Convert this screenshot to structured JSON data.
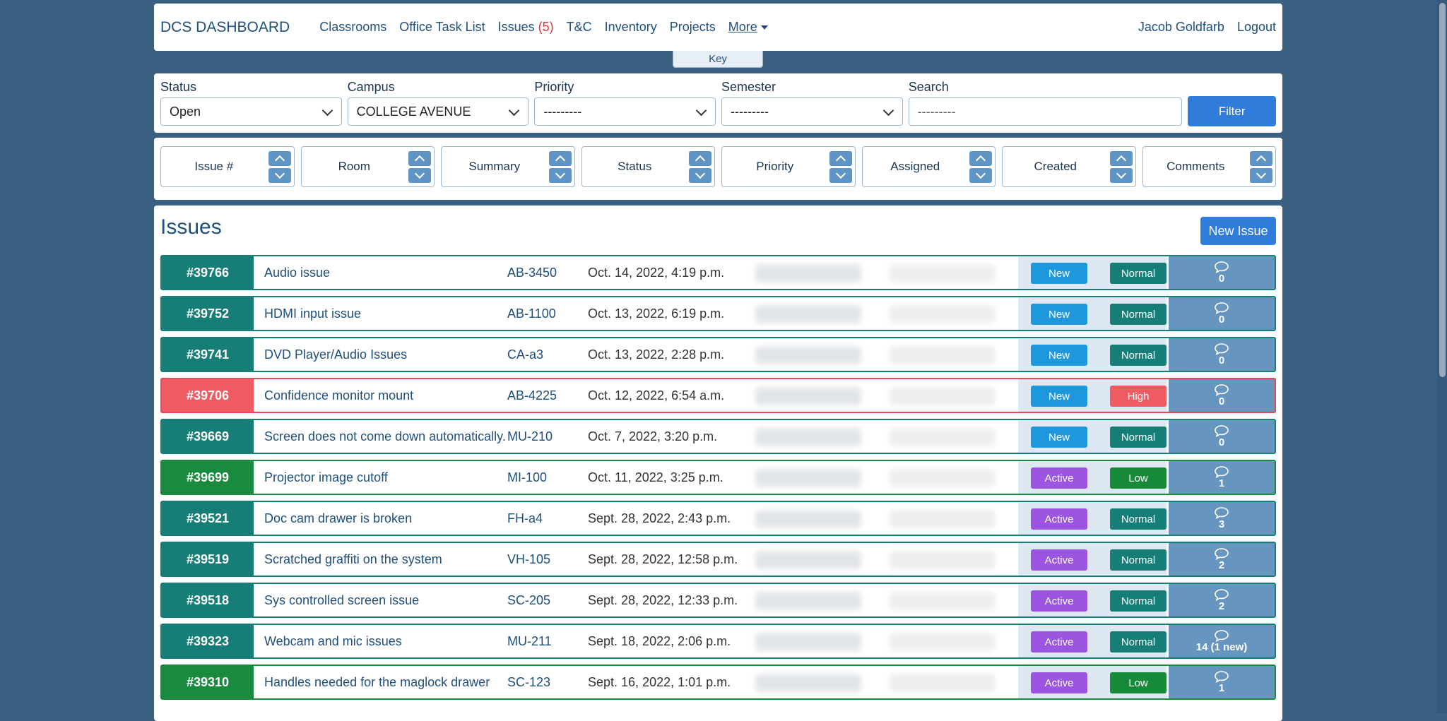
{
  "navbar": {
    "brand": "DCS DASHBOARD",
    "links": {
      "classrooms": "Classrooms",
      "office_task_list": "Office Task List",
      "issues": "Issues",
      "issues_count": "(5)",
      "tc": "T&C",
      "inventory": "Inventory",
      "projects": "Projects",
      "more": "More"
    },
    "user": "Jacob Goldfarb",
    "logout": "Logout",
    "key": "Key"
  },
  "filters": {
    "status": {
      "label": "Status",
      "value": "Open"
    },
    "campus": {
      "label": "Campus",
      "value": "COLLEGE AVENUE"
    },
    "priority": {
      "label": "Priority",
      "value": "---------"
    },
    "semester": {
      "label": "Semester",
      "value": "---------"
    },
    "search": {
      "label": "Search",
      "placeholder": "---------"
    },
    "filter_button": "Filter"
  },
  "sort_columns": [
    "Issue #",
    "Room",
    "Summary",
    "Status",
    "Priority",
    "Assigned",
    "Created",
    "Comments"
  ],
  "issues": {
    "title": "Issues",
    "new_issue_button": "New Issue",
    "rows": [
      {
        "num": "#39766",
        "summary": "Audio issue",
        "room": "AB-3450",
        "created": "Oct. 14, 2022, 4:19 p.m.",
        "status": "New",
        "priority": "Normal",
        "comments": "0"
      },
      {
        "num": "#39752",
        "summary": "HDMI input issue",
        "room": "AB-1100",
        "created": "Oct. 13, 2022, 6:19 p.m.",
        "status": "New",
        "priority": "Normal",
        "comments": "0"
      },
      {
        "num": "#39741",
        "summary": "DVD Player/Audio Issues",
        "room": "CA-a3",
        "created": "Oct. 13, 2022, 2:28 p.m.",
        "status": "New",
        "priority": "Normal",
        "comments": "0"
      },
      {
        "num": "#39706",
        "summary": "Confidence monitor mount",
        "room": "AB-4225",
        "created": "Oct. 12, 2022, 6:54 a.m.",
        "status": "New",
        "priority": "High",
        "comments": "0"
      },
      {
        "num": "#39669",
        "summary": "Screen does not come down automatically.",
        "room": "MU-210",
        "created": "Oct. 7, 2022, 3:20 p.m.",
        "status": "New",
        "priority": "Normal",
        "comments": "0"
      },
      {
        "num": "#39699",
        "summary": "Projector image cutoff",
        "room": "MI-100",
        "created": "Oct. 11, 2022, 3:25 p.m.",
        "status": "Active",
        "priority": "Low",
        "comments": "1"
      },
      {
        "num": "#39521",
        "summary": "Doc cam drawer is broken",
        "room": "FH-a4",
        "created": "Sept. 28, 2022, 2:43 p.m.",
        "status": "Active",
        "priority": "Normal",
        "comments": "3"
      },
      {
        "num": "#39519",
        "summary": "Scratched graffiti on the system",
        "room": "VH-105",
        "created": "Sept. 28, 2022, 12:58 p.m.",
        "status": "Active",
        "priority": "Normal",
        "comments": "2"
      },
      {
        "num": "#39518",
        "summary": "Sys controlled screen issue",
        "room": "SC-205",
        "created": "Sept. 28, 2022, 12:33 p.m.",
        "status": "Active",
        "priority": "Normal",
        "comments": "2"
      },
      {
        "num": "#39323",
        "summary": "Webcam and mic issues",
        "room": "MU-211",
        "created": "Sept. 18, 2022, 2:06 p.m.",
        "status": "Active",
        "priority": "Normal",
        "comments": "14 (1 new)"
      },
      {
        "num": "#39310",
        "summary": "Handles needed for the maglock drawer",
        "room": "SC-123",
        "created": "Sept. 16, 2022, 1:01 p.m.",
        "status": "Active",
        "priority": "Low",
        "comments": "1"
      }
    ]
  },
  "colors": {
    "background": "#3a5f80",
    "normal": "#177d77",
    "high": "#f05a63",
    "low": "#1a8a3f",
    "status_new": "#1f97dc",
    "status_active": "#9b55e0",
    "comments": "#6696c0",
    "primary_button": "#2f7cdb"
  },
  "icons": {
    "comments": "speech-bubble-icon",
    "dropdown": "chevron-down-icon",
    "sort": "chevron-up-down-icon"
  }
}
